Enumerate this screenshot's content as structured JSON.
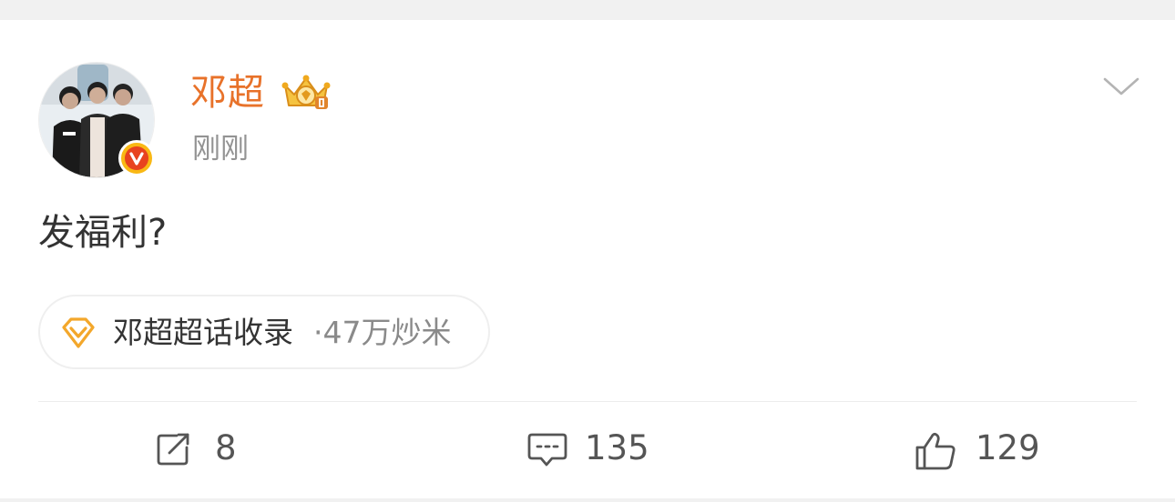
{
  "post": {
    "author": "邓超",
    "timestamp": "刚刚",
    "text": "发福利?",
    "topic": {
      "name": "邓超超话收录",
      "stats": "·47万炒米"
    }
  },
  "actions": {
    "repost_count": "8",
    "comment_count": "135",
    "like_count": "129"
  },
  "icons": {
    "verified": "verified-v-icon",
    "vip": "vip-crown-icon",
    "menu": "chevron-down-icon",
    "topic": "diamond-icon",
    "repost": "repost-icon",
    "comment": "comment-icon",
    "like": "thumbs-up-icon"
  },
  "colors": {
    "author_name": "#e8722a",
    "verified_badge": "#f9b814",
    "verified_inner": "#e8431f",
    "topic_diamond": "#f3a72b"
  }
}
